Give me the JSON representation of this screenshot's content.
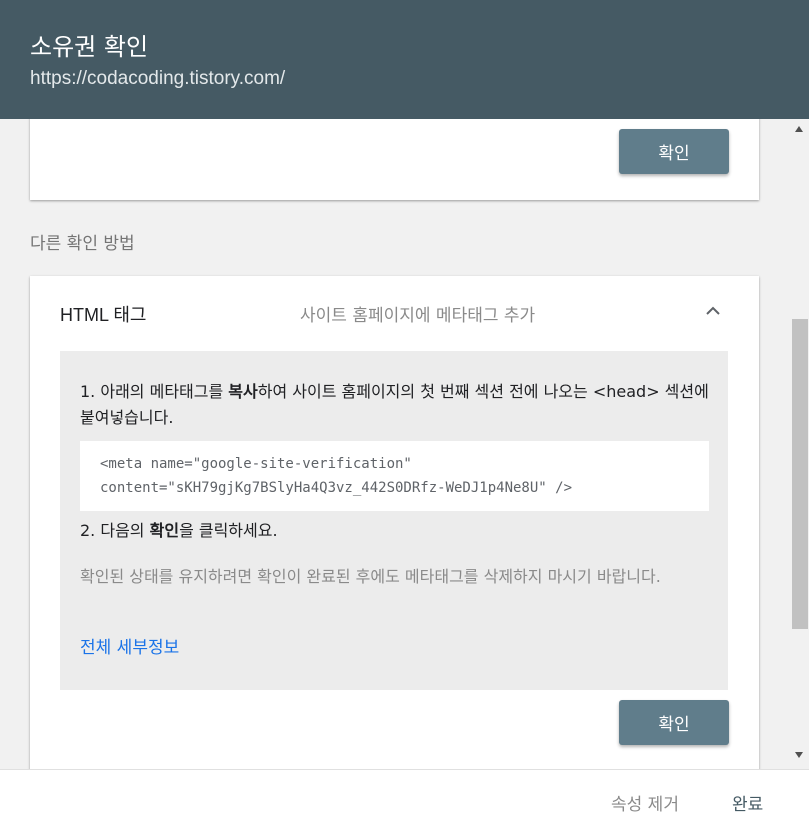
{
  "header": {
    "title": "소유권 확인",
    "url": "https://codacoding.tistory.com/"
  },
  "top_card": {
    "verify_label": "확인"
  },
  "other_methods_label": "다른 확인 방법",
  "html_tag_card": {
    "method": "HTML 태그",
    "description": "사이트 홈페이지에 메타태그 추가",
    "step1_prefix": "1. 아래의 메타태그를 ",
    "step1_bold": "복사",
    "step1_suffix": "하여 사이트 홈페이지의 첫 번째 섹션 전에 나오는 <head> 섹션에 붙여넣습니다.",
    "code_line1": "<meta name=\"google-site-verification\"",
    "code_line2": "content=\"sKH79gjKg7BSlyHa4Q3vz_442S0DRfz-WeDJ1p4Ne8U\" />",
    "step2_prefix": "2. 다음의 ",
    "step2_bold": "확인",
    "step2_suffix": "을 클릭하세요.",
    "note": "확인된 상태를 유지하려면 확인이 완료된 후에도 메타태그를 삭제하지 마시기 바랍니다.",
    "details_link": "전체 세부정보",
    "verify_label": "확인"
  },
  "footer": {
    "remove_label": "속성 제거",
    "done_label": "완료"
  },
  "colors": {
    "header_bg": "#455a64",
    "button_bg": "#607d8b",
    "link": "#1a73e8"
  }
}
